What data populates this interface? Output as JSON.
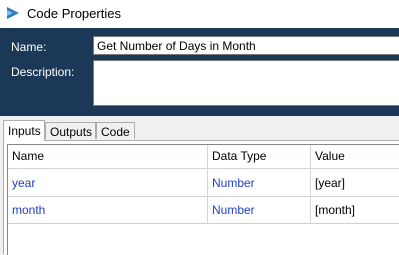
{
  "window": {
    "title": "Code Properties",
    "icon": "code-stage-icon"
  },
  "form": {
    "name_label": "Name:",
    "name_value": "Get Number of Days in Month",
    "description_label": "Description:",
    "description_value": ""
  },
  "tabs": [
    {
      "label": "Inputs",
      "active": true
    },
    {
      "label": "Outputs",
      "active": false
    },
    {
      "label": "Code",
      "active": false
    }
  ],
  "table": {
    "columns": [
      "Name",
      "Data Type",
      "Value"
    ],
    "rows": [
      {
        "name": "year",
        "type": "Number",
        "value": "[year]"
      },
      {
        "name": "month",
        "type": "Number",
        "value": "[month]"
      }
    ]
  },
  "colors": {
    "header_panel": "#1b3957",
    "link_text": "#1f3fcc"
  }
}
